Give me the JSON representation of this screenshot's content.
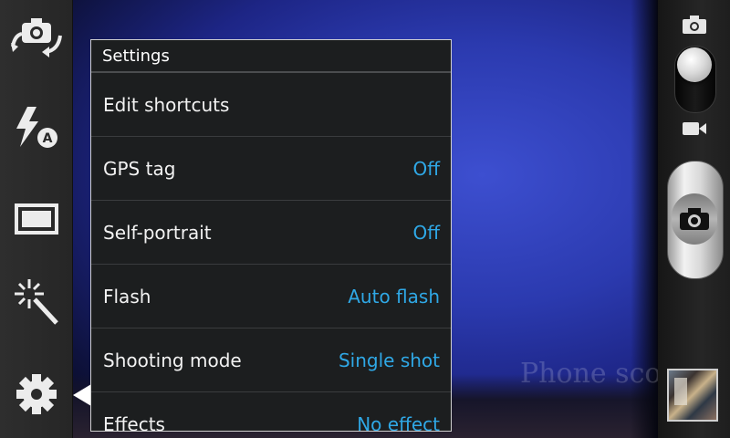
{
  "settings": {
    "title": "Settings",
    "rows": [
      {
        "label": "Edit shortcuts",
        "value": ""
      },
      {
        "label": "GPS tag",
        "value": "Off"
      },
      {
        "label": "Self-portrait",
        "value": "Off"
      },
      {
        "label": "Flash",
        "value": "Auto flash"
      },
      {
        "label": "Shooting mode",
        "value": "Single shot"
      },
      {
        "label": "Effects",
        "value": "No effect"
      }
    ]
  },
  "watermark": "Phone scoop",
  "icons": {
    "left": [
      "switch-camera-icon",
      "flash-auto-icon",
      "aspect-ratio-icon",
      "scene-magic-icon",
      "settings-gear-icon"
    ],
    "right": [
      "camera-mode-icon",
      "video-mode-icon",
      "shutter-camera-icon"
    ]
  },
  "colors": {
    "accent": "#2fa8e6",
    "panel_bg": "#1c1e1f"
  }
}
